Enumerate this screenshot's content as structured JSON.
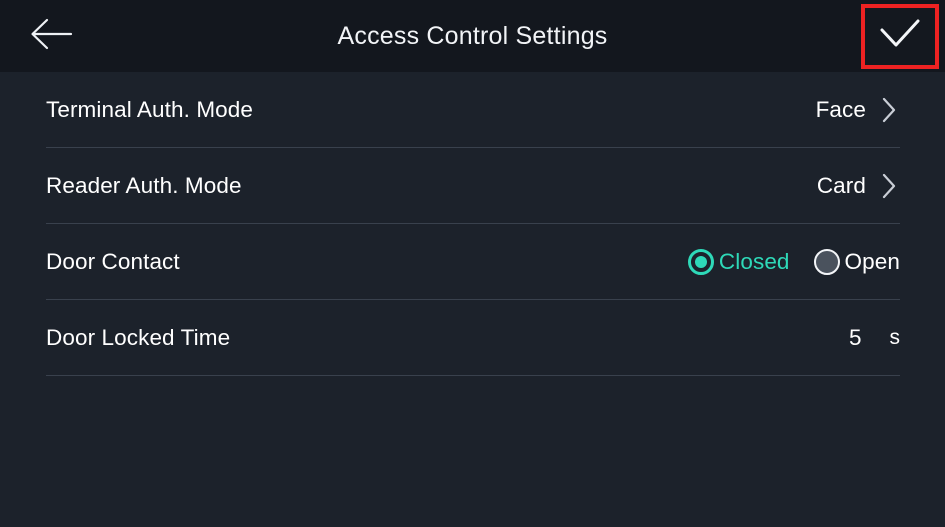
{
  "header": {
    "title": "Access Control Settings",
    "back_icon": "arrow-left-icon",
    "confirm_icon": "check-icon",
    "highlight_color": "#ee2222"
  },
  "colors": {
    "header_bg": "#13171e",
    "body_bg": "#1c222b",
    "divider": "#39414d",
    "accent": "#2ed9b8",
    "text": "#ffffff"
  },
  "rows": [
    {
      "label": "Terminal Auth. Mode",
      "value": "Face",
      "chevron_icon": "chevron-right-icon"
    },
    {
      "label": "Reader Auth. Mode",
      "value": "Card",
      "chevron_icon": "chevron-right-icon"
    },
    {
      "label": "Door Contact",
      "options": [
        {
          "label": "Closed",
          "selected": true
        },
        {
          "label": "Open",
          "selected": false
        }
      ]
    },
    {
      "label": "Door Locked Time",
      "value": "5",
      "unit": "s"
    }
  ]
}
